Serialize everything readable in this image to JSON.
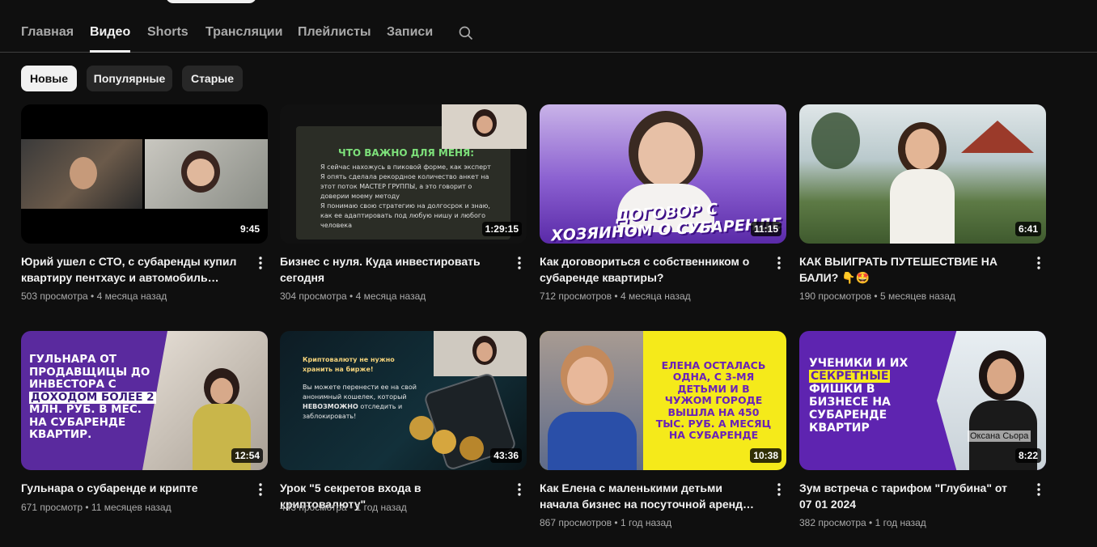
{
  "tabs": [
    {
      "label": "Главная"
    },
    {
      "label": "Видео"
    },
    {
      "label": "Shorts"
    },
    {
      "label": "Трансляции"
    },
    {
      "label": "Плейлисты"
    },
    {
      "label": "Записи"
    }
  ],
  "chips": [
    {
      "label": "Новые"
    },
    {
      "label": "Популярные"
    },
    {
      "label": "Старые"
    }
  ],
  "videos": [
    {
      "title": "Юрий ушел с СТО, с субаренды купил квартиру пентхаус и автомобиль Лексус...",
      "views": "503 просмотра",
      "age": "4 месяца назад",
      "duration": "9:45"
    },
    {
      "title": "Бизнес с нуля. Куда инвестировать сегодня",
      "views": "304 просмотра",
      "age": "4 месяца назад",
      "duration": "1:29:15"
    },
    {
      "title": "Как договориться с собственником о субаренде квартиры?",
      "views": "712 просмотров",
      "age": "4 месяца назад",
      "duration": "11:15"
    },
    {
      "title": "КАК ВЫИГРАТЬ ПУТЕШЕСТВИЕ НА БАЛИ? 👇🤩",
      "views": "190 просмотров",
      "age": "5 месяцев назад",
      "duration": "6:41"
    },
    {
      "title": "Гульнара о субаренде и крипте",
      "views": "671 просмотр",
      "age": "11 месяцев назад",
      "duration": "12:54"
    },
    {
      "title": "Урок \"5 секретов входа в криптовалюту\"",
      "views": "443 просмотра",
      "age": "1 год назад",
      "duration": "43:36"
    },
    {
      "title": "Как Елена с маленькими детьми начала бизнес на посуточной аренде квартир и...",
      "views": "867 просмотров",
      "age": "1 год назад",
      "duration": "10:38"
    },
    {
      "title": "Зум встреча с тарифом \"Глубина\" от 07 01 2024",
      "views": "382 просмотра",
      "age": "1 год назад",
      "duration": "8:22"
    }
  ],
  "thumbs": {
    "t2": {
      "heading": "ЧТО ВАЖНО ДЛЯ МЕНЯ:",
      "b1": "Я сейчас нахожусь в пиковой форме, как эксперт",
      "b2": "Я опять сделала рекордное количество анкет на этот поток МАСТЕР ГРУППЫ, а это говорит о доверии моему методу",
      "b3": "Я понимаю свою стратегию на долгосрок и знаю, как ее адаптировать под любую нишу и любого человека"
    },
    "t3": {
      "line1": "ДОГОВОР С",
      "line2": "ХОЗЯИНОМ О СУБАРЕНДЕ"
    },
    "t5": {
      "l1": "ГУЛЬНАРА ОТ",
      "l2": "ПРОДАВЩИЦЫ ДО",
      "l3": "ИНВЕСТОРА С",
      "l4": "ДОХОДОМ БОЛЕЕ 2",
      "l5": "МЛН. РУБ. В МЕС.",
      "l6": "НА СУБАРЕНДЕ",
      "l7": "КВАРТИР."
    },
    "t6": {
      "q": "Криптовалюту не нужно хранить на бирже!",
      "body1": "Вы можете перенести ее на свой анонимный кошелек, который",
      "body2": "НЕВОЗМОЖНО",
      "body3": "отследить и заблокировать!"
    },
    "t7": {
      "text": "ЕЛЕНА ОСТАЛАСЬ ОДНА, С 3-МЯ ДЕТЬМИ И В ЧУЖОМ ГОРОДЕ ВЫШЛА НА 450 ТЫС. РУБ. А МЕСЯЦ НА СУБАРЕНДЕ"
    },
    "t8": {
      "l1": "УЧЕНИКИ И ИХ",
      "l2": "СЕКРЕТНЫЕ",
      "l3": "ФИШКИ В",
      "l4": "БИЗНЕСЕ НА",
      "l5": "СУБАРЕНДЕ",
      "l6": "КВАРТИР",
      "name": "Оксана Сьора"
    }
  }
}
